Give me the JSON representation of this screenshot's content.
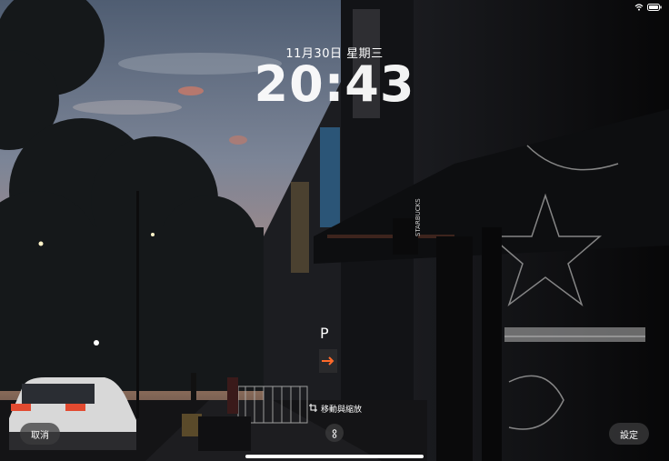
{
  "lock_screen": {
    "date": "11月30日 星期三",
    "time": "20:43"
  },
  "controls": {
    "cancel_label": "取消",
    "settings_label": "設定",
    "move_zoom_label": "移動與縮放"
  },
  "wallpaper": {
    "parking_sign": "P",
    "store_sign": "STARBUCKS",
    "colors": {
      "sky_top": "#5e6f86",
      "sky_mid": "#7a8498",
      "sky_sunset": "#c88e70",
      "street_dark": "#0d0d0f"
    }
  },
  "icons": {
    "wifi": "wifi-icon",
    "battery": "battery-icon",
    "crop": "crop-icon",
    "tune": "adjust-icon"
  }
}
